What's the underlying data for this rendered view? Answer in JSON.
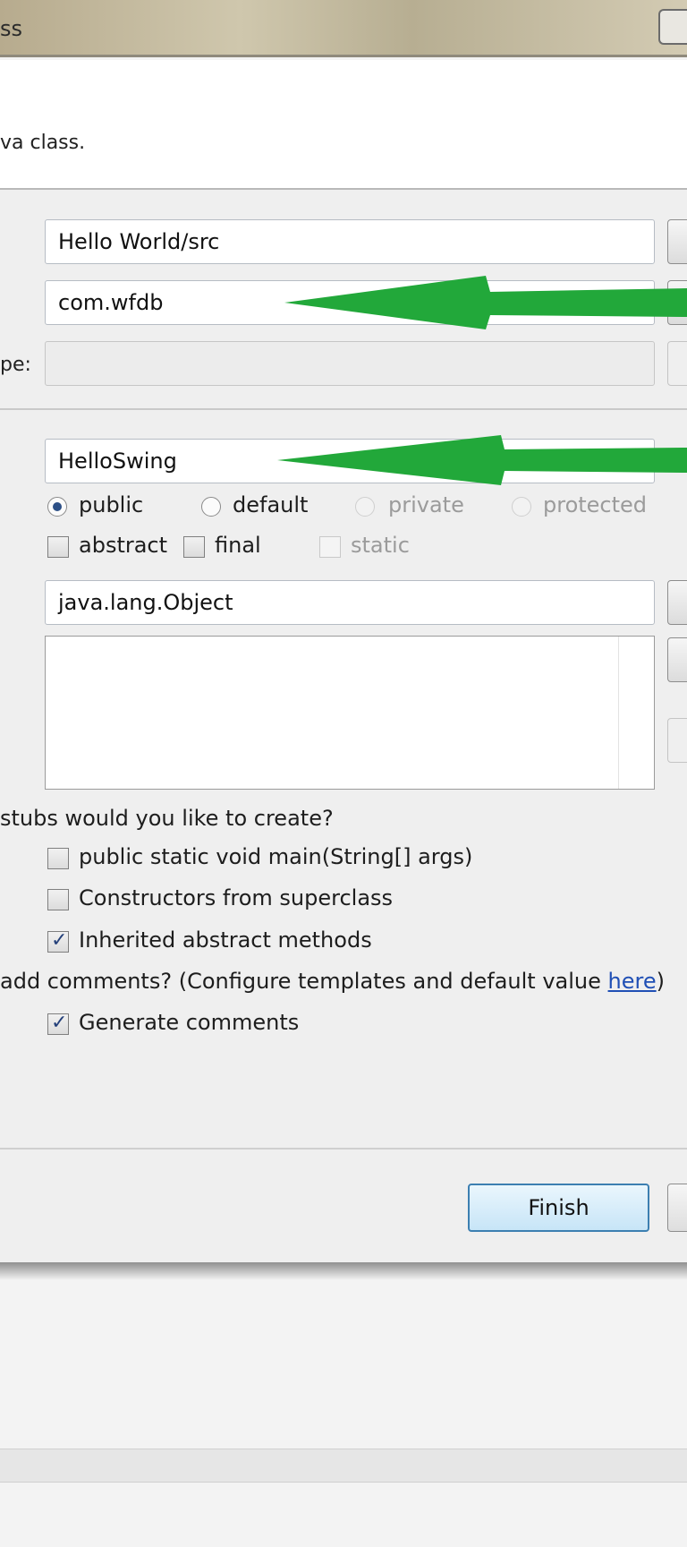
{
  "title": "ss",
  "header": {
    "description": "va class."
  },
  "source_folder": {
    "value": "Hello World/src"
  },
  "package": {
    "value": "com.wfdb"
  },
  "enclosing_type": {
    "label": "pe:",
    "value": ""
  },
  "name": {
    "value": "HelloSwing"
  },
  "modifiers": {
    "radios": [
      {
        "label": "public",
        "selected": true,
        "enabled": true
      },
      {
        "label": "default",
        "selected": false,
        "enabled": true
      },
      {
        "label": "private",
        "selected": false,
        "enabled": false
      },
      {
        "label": "protected",
        "selected": false,
        "enabled": false
      }
    ],
    "checks": [
      {
        "label": "abstract",
        "checked": false,
        "enabled": true
      },
      {
        "label": "final",
        "checked": false,
        "enabled": true
      },
      {
        "label": "static",
        "checked": false,
        "enabled": false
      }
    ]
  },
  "superclass": {
    "value": "java.lang.Object"
  },
  "stubs": {
    "question": "stubs would you like to create?",
    "options": [
      {
        "label": "public static void main(String[] args)",
        "checked": false
      },
      {
        "label": "Constructors from superclass",
        "checked": false
      },
      {
        "label": "Inherited abstract methods",
        "checked": true
      }
    ]
  },
  "comments": {
    "question": "add comments? (Configure templates and default value ",
    "link": "here",
    "close": ")",
    "option": {
      "label": "Generate comments",
      "checked": true
    }
  },
  "buttons": {
    "finish": "Finish"
  },
  "colors": {
    "arrow": "#22a83a",
    "finish_border": "#3c7fb1"
  }
}
